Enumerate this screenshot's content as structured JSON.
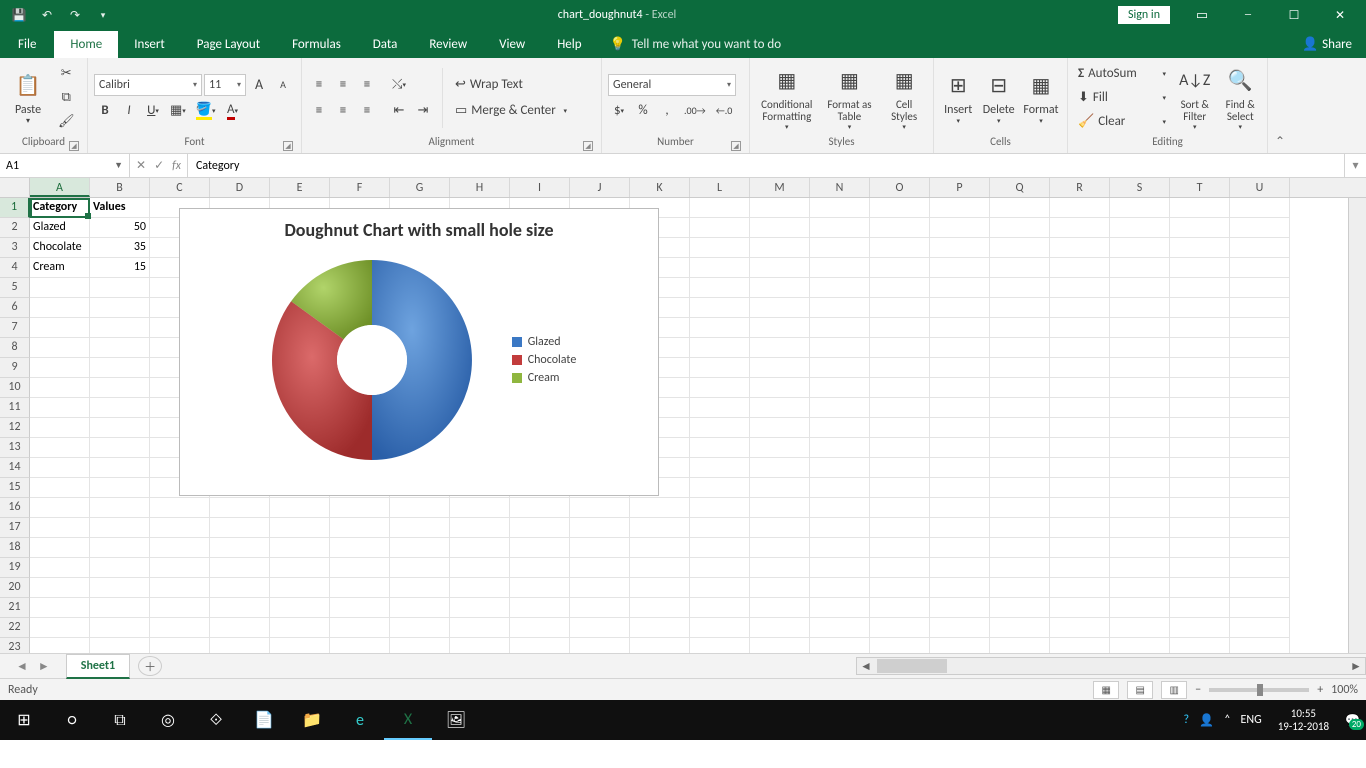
{
  "titlebar": {
    "doc": "chart_doughnut4",
    "app": "Excel",
    "signin": "Sign in"
  },
  "tabs": {
    "file": "File",
    "list": [
      "Home",
      "Insert",
      "Page Layout",
      "Formulas",
      "Data",
      "Review",
      "View",
      "Help"
    ],
    "active": "Home",
    "tellme": "Tell me what you want to do",
    "share": "Share"
  },
  "ribbon": {
    "clipboard": {
      "paste": "Paste",
      "label": "Clipboard"
    },
    "font": {
      "name": "Calibri",
      "size": "11",
      "label": "Font"
    },
    "alignment": {
      "wrap": "Wrap Text",
      "merge": "Merge & Center",
      "label": "Alignment"
    },
    "number": {
      "format": "General",
      "label": "Number"
    },
    "styles": {
      "cond": "Conditional Formatting",
      "table": "Format as Table",
      "cell": "Cell Styles",
      "label": "Styles"
    },
    "cells": {
      "insert": "Insert",
      "delete": "Delete",
      "format": "Format",
      "label": "Cells"
    },
    "editing": {
      "sum": "AutoSum",
      "fill": "Fill",
      "clear": "Clear",
      "sort": "Sort & Filter",
      "find": "Find & Select",
      "label": "Editing"
    }
  },
  "namebox": "A1",
  "formula": "Category",
  "columns": [
    "A",
    "B",
    "C",
    "D",
    "E",
    "F",
    "G",
    "H",
    "I",
    "J",
    "K",
    "L",
    "M",
    "N",
    "O",
    "P",
    "Q",
    "R",
    "S",
    "T",
    "U"
  ],
  "rowcount": 23,
  "cells": {
    "A1": "Category",
    "B1": "Values",
    "A2": "Glazed",
    "B2": "50",
    "A3": "Chocolate",
    "B3": "35",
    "A4": "Cream",
    "B4": "15"
  },
  "chart_data": {
    "type": "doughnut",
    "title": "Doughnut Chart with small hole size",
    "categories": [
      "Glazed",
      "Chocolate",
      "Cream"
    ],
    "values": [
      50,
      35,
      15
    ],
    "colors": [
      "#3b78c4",
      "#c23c3c",
      "#8fb63f"
    ],
    "hole_ratio": 0.35
  },
  "sheet": {
    "name": "Sheet1"
  },
  "status": {
    "ready": "Ready",
    "zoom": "100%"
  },
  "system": {
    "lang": "ENG",
    "time": "10:55",
    "date": "19-12-2018",
    "notif": "20"
  }
}
